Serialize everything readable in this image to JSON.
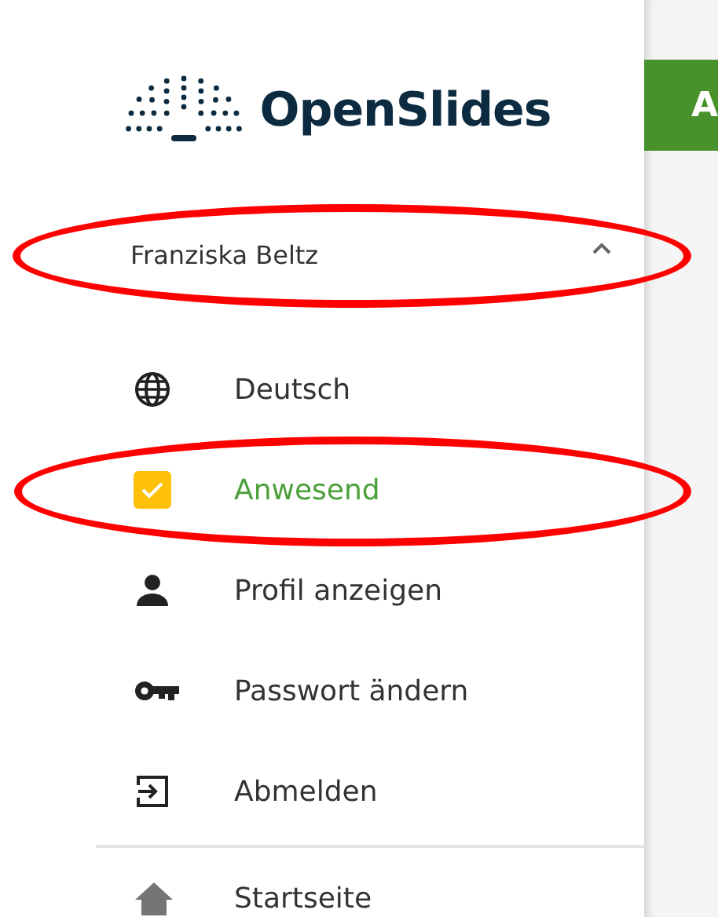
{
  "header": {
    "title": "A"
  },
  "logo": {
    "text": "OpenSlides"
  },
  "user": {
    "name": "Franziska Beltz",
    "expanded": true,
    "circled": true
  },
  "user_menu": [
    {
      "kind": "language",
      "label": "Deutsch",
      "circled": false
    },
    {
      "kind": "presence",
      "label": "Anwesend",
      "checked": true,
      "circled": true
    },
    {
      "kind": "profile",
      "label": "Profil anzeigen",
      "circled": false
    },
    {
      "kind": "password",
      "label": "Passwort ändern",
      "circled": false
    },
    {
      "kind": "logout",
      "label": "Abmelden",
      "circled": false
    }
  ],
  "nav_items": [
    {
      "kind": "home",
      "label": "Startseite"
    }
  ]
}
